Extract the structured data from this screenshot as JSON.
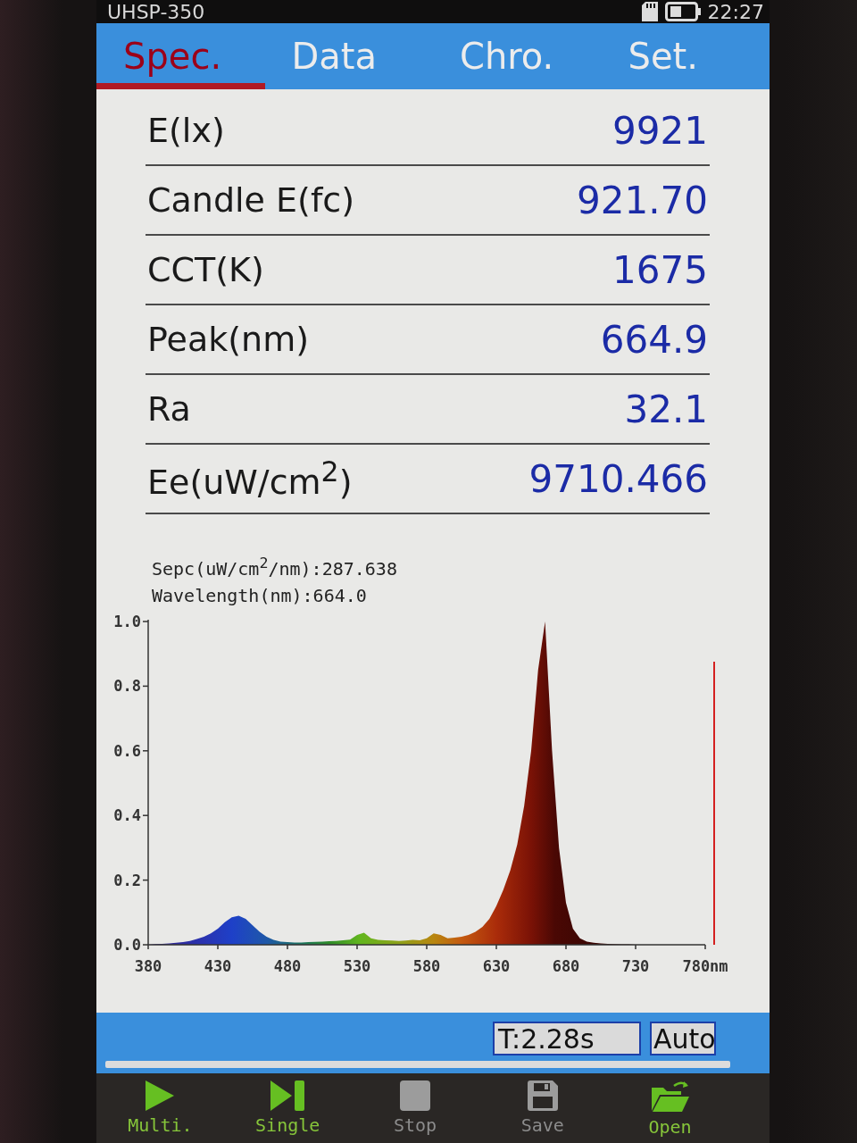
{
  "status_bar": {
    "model": "UHSP-350",
    "time": "22:27"
  },
  "tabs": [
    {
      "label": "Spec.",
      "selected": true
    },
    {
      "label": "Data",
      "selected": false
    },
    {
      "label": "Chro.",
      "selected": false
    },
    {
      "label": "Set.",
      "selected": false
    }
  ],
  "measurements": [
    {
      "label": "E(lx)",
      "value": "9921"
    },
    {
      "label": "Candle E(fc)",
      "value": "921.70"
    },
    {
      "label": "CCT(K)",
      "value": "1675"
    },
    {
      "label": "Peak(nm)",
      "value": "664.9"
    },
    {
      "label": "Ra",
      "value": "32.1"
    },
    {
      "label": "Ee(uW/cm$^{2}$)",
      "value": "9710.466"
    }
  ],
  "spectrum": {
    "readouts": [
      "Sepc(uW/cm$^{2}$/nm):287.638",
      "Wavelength(nm):664.0"
    ],
    "chart_data": {
      "type": "area",
      "x": [
        380,
        385,
        390,
        395,
        400,
        405,
        410,
        415,
        420,
        425,
        430,
        435,
        440,
        445,
        450,
        455,
        460,
        465,
        470,
        475,
        480,
        485,
        490,
        495,
        500,
        505,
        510,
        515,
        520,
        525,
        530,
        535,
        540,
        545,
        550,
        555,
        560,
        565,
        570,
        575,
        580,
        585,
        590,
        595,
        600,
        605,
        610,
        615,
        620,
        625,
        630,
        635,
        640,
        645,
        650,
        655,
        660,
        665,
        670,
        675,
        680,
        685,
        690,
        695,
        700,
        705,
        710,
        715,
        720,
        725,
        730,
        735,
        740,
        745,
        750,
        755,
        760,
        765,
        770,
        775,
        780
      ],
      "values": [
        0,
        0.002,
        0.003,
        0.004,
        0.006,
        0.008,
        0.012,
        0.018,
        0.025,
        0.035,
        0.05,
        0.07,
        0.085,
        0.09,
        0.08,
        0.06,
        0.04,
        0.025,
        0.015,
        0.01,
        0.008,
        0.007,
        0.007,
        0.008,
        0.009,
        0.01,
        0.011,
        0.012,
        0.014,
        0.016,
        0.03,
        0.037,
        0.02,
        0.015,
        0.014,
        0.013,
        0.012,
        0.013,
        0.015,
        0.014,
        0.02,
        0.035,
        0.03,
        0.02,
        0.022,
        0.025,
        0.03,
        0.04,
        0.055,
        0.08,
        0.12,
        0.17,
        0.23,
        0.31,
        0.43,
        0.6,
        0.85,
        1.0,
        0.6,
        0.3,
        0.13,
        0.05,
        0.02,
        0.01,
        0.006,
        0.004,
        0.003,
        0.002,
        0.001,
        0.001,
        0,
        0,
        0,
        0,
        0,
        0,
        0,
        0,
        0,
        0,
        0
      ],
      "xlim": [
        380,
        780
      ],
      "ylim": [
        0,
        1
      ],
      "xticks": [
        380,
        430,
        480,
        530,
        580,
        630,
        680,
        730,
        {
          "value": 780,
          "label": "780nm"
        }
      ],
      "yticks": [
        {
          "value": 0,
          "label": "0.0"
        },
        {
          "value": 0.2,
          "label": "0.2"
        },
        {
          "value": 0.4,
          "label": "0.4"
        },
        {
          "value": 0.6,
          "label": "0.6"
        },
        {
          "value": 0.8,
          "label": "0.8"
        },
        {
          "value": 1,
          "label": "1.0"
        }
      ]
    }
  },
  "acquisition": {
    "time": "T:2.28s",
    "mode": "Auto"
  },
  "toolbar": [
    {
      "kind": "play",
      "label": "Multi.",
      "disabled": false
    },
    {
      "kind": "single",
      "label": "Single",
      "disabled": false
    },
    {
      "kind": "stop",
      "label": "Stop",
      "disabled": true
    },
    {
      "kind": "save",
      "label": "Save",
      "disabled": true
    },
    {
      "kind": "open",
      "label": "Open",
      "disabled": false
    }
  ]
}
